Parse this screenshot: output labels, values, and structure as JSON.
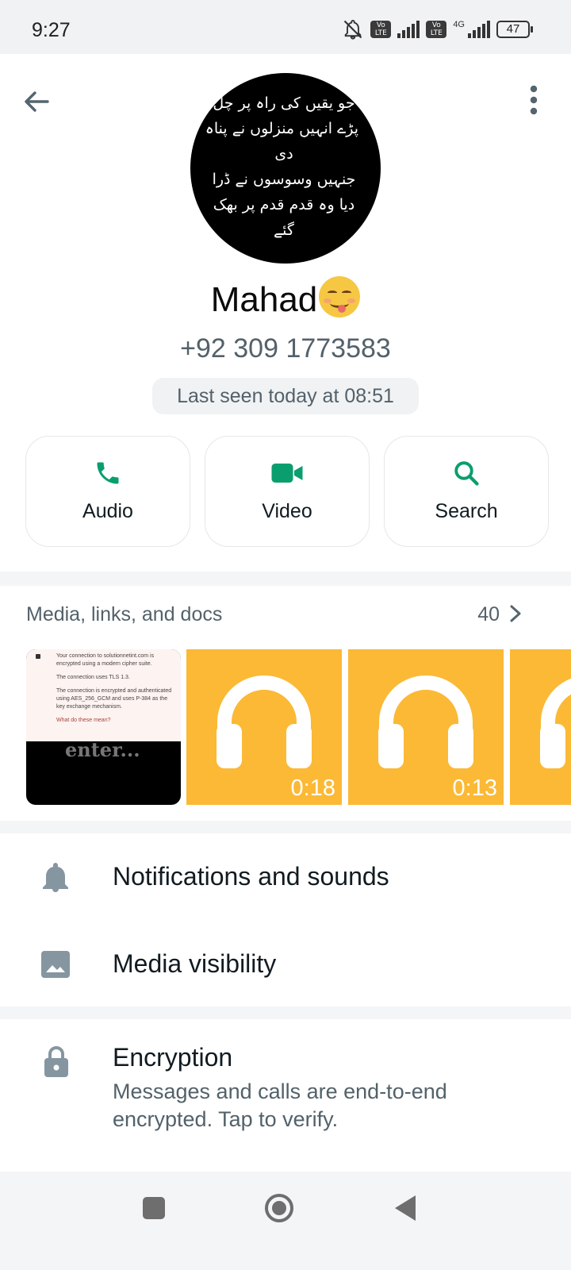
{
  "status_bar": {
    "time": "9:27",
    "volte_1": "Vo LTE",
    "volte_2": "Vo LTE",
    "network": "4G",
    "battery": "47",
    "icons": [
      "bell-off-icon",
      "signal-icon",
      "signal-icon",
      "battery-icon"
    ]
  },
  "header": {
    "back_icon": "arrow-left-icon",
    "menu_icon": "more-vertical-icon"
  },
  "profile": {
    "avatar_lines": [
      "جو یقیں کی راہ پر چل",
      "پڑے انہیں منزلوں نے پناہ",
      "دی",
      "جنہیں  وسوسوں  نے ڈرا",
      "دیا وہ قدم  قدم پر بھک",
      "گئے"
    ],
    "name": "Mahad",
    "name_emoji": "face-savoring-food-emoji",
    "phone": "+92 309 1773583",
    "last_seen": "Last seen today at 08:51"
  },
  "actions": [
    {
      "label": "Audio",
      "icon": "phone-icon"
    },
    {
      "label": "Video",
      "icon": "video-camera-icon"
    },
    {
      "label": "Search",
      "icon": "search-icon"
    }
  ],
  "media": {
    "heading": "Media, links, and docs",
    "count": "40",
    "screenshot_text": {
      "line1": "Your connection to solutionnetint.com is encrypted  using a modern cipher suite.",
      "line2": "The connection uses TLS 1.3.",
      "line3": "The connection is encrypted and authenticated using AES_256_GCM and uses P-384 as the key exchange mechanism.",
      "link": "What do these mean?",
      "overlay": "enter..."
    },
    "audio_items": [
      {
        "duration": "0:18",
        "icon": "headphones-icon"
      },
      {
        "duration": "0:13",
        "icon": "headphones-icon"
      }
    ]
  },
  "settings": {
    "notifications": "Notifications and sounds",
    "media_visibility": "Media visibility"
  },
  "encryption": {
    "title": "Encryption",
    "subtitle": "Messages and calls are end-to-end encrypted. Tap to verify."
  },
  "colors": {
    "accent": "#0a9e6e",
    "audio_thumb": "#fbb936",
    "secondary_text": "#53616a"
  }
}
